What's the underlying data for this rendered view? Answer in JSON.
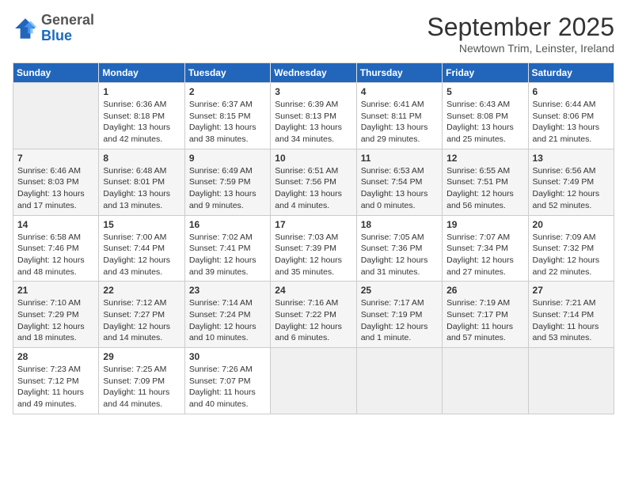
{
  "logo": {
    "general": "General",
    "blue": "Blue"
  },
  "header": {
    "month": "September 2025",
    "location": "Newtown Trim, Leinster, Ireland"
  },
  "weekdays": [
    "Sunday",
    "Monday",
    "Tuesday",
    "Wednesday",
    "Thursday",
    "Friday",
    "Saturday"
  ],
  "weeks": [
    [
      {
        "day": "",
        "info": ""
      },
      {
        "day": "1",
        "info": "Sunrise: 6:36 AM\nSunset: 8:18 PM\nDaylight: 13 hours\nand 42 minutes."
      },
      {
        "day": "2",
        "info": "Sunrise: 6:37 AM\nSunset: 8:15 PM\nDaylight: 13 hours\nand 38 minutes."
      },
      {
        "day": "3",
        "info": "Sunrise: 6:39 AM\nSunset: 8:13 PM\nDaylight: 13 hours\nand 34 minutes."
      },
      {
        "day": "4",
        "info": "Sunrise: 6:41 AM\nSunset: 8:11 PM\nDaylight: 13 hours\nand 29 minutes."
      },
      {
        "day": "5",
        "info": "Sunrise: 6:43 AM\nSunset: 8:08 PM\nDaylight: 13 hours\nand 25 minutes."
      },
      {
        "day": "6",
        "info": "Sunrise: 6:44 AM\nSunset: 8:06 PM\nDaylight: 13 hours\nand 21 minutes."
      }
    ],
    [
      {
        "day": "7",
        "info": "Sunrise: 6:46 AM\nSunset: 8:03 PM\nDaylight: 13 hours\nand 17 minutes."
      },
      {
        "day": "8",
        "info": "Sunrise: 6:48 AM\nSunset: 8:01 PM\nDaylight: 13 hours\nand 13 minutes."
      },
      {
        "day": "9",
        "info": "Sunrise: 6:49 AM\nSunset: 7:59 PM\nDaylight: 13 hours\nand 9 minutes."
      },
      {
        "day": "10",
        "info": "Sunrise: 6:51 AM\nSunset: 7:56 PM\nDaylight: 13 hours\nand 4 minutes."
      },
      {
        "day": "11",
        "info": "Sunrise: 6:53 AM\nSunset: 7:54 PM\nDaylight: 13 hours\nand 0 minutes."
      },
      {
        "day": "12",
        "info": "Sunrise: 6:55 AM\nSunset: 7:51 PM\nDaylight: 12 hours\nand 56 minutes."
      },
      {
        "day": "13",
        "info": "Sunrise: 6:56 AM\nSunset: 7:49 PM\nDaylight: 12 hours\nand 52 minutes."
      }
    ],
    [
      {
        "day": "14",
        "info": "Sunrise: 6:58 AM\nSunset: 7:46 PM\nDaylight: 12 hours\nand 48 minutes."
      },
      {
        "day": "15",
        "info": "Sunrise: 7:00 AM\nSunset: 7:44 PM\nDaylight: 12 hours\nand 43 minutes."
      },
      {
        "day": "16",
        "info": "Sunrise: 7:02 AM\nSunset: 7:41 PM\nDaylight: 12 hours\nand 39 minutes."
      },
      {
        "day": "17",
        "info": "Sunrise: 7:03 AM\nSunset: 7:39 PM\nDaylight: 12 hours\nand 35 minutes."
      },
      {
        "day": "18",
        "info": "Sunrise: 7:05 AM\nSunset: 7:36 PM\nDaylight: 12 hours\nand 31 minutes."
      },
      {
        "day": "19",
        "info": "Sunrise: 7:07 AM\nSunset: 7:34 PM\nDaylight: 12 hours\nand 27 minutes."
      },
      {
        "day": "20",
        "info": "Sunrise: 7:09 AM\nSunset: 7:32 PM\nDaylight: 12 hours\nand 22 minutes."
      }
    ],
    [
      {
        "day": "21",
        "info": "Sunrise: 7:10 AM\nSunset: 7:29 PM\nDaylight: 12 hours\nand 18 minutes."
      },
      {
        "day": "22",
        "info": "Sunrise: 7:12 AM\nSunset: 7:27 PM\nDaylight: 12 hours\nand 14 minutes."
      },
      {
        "day": "23",
        "info": "Sunrise: 7:14 AM\nSunset: 7:24 PM\nDaylight: 12 hours\nand 10 minutes."
      },
      {
        "day": "24",
        "info": "Sunrise: 7:16 AM\nSunset: 7:22 PM\nDaylight: 12 hours\nand 6 minutes."
      },
      {
        "day": "25",
        "info": "Sunrise: 7:17 AM\nSunset: 7:19 PM\nDaylight: 12 hours\nand 1 minute."
      },
      {
        "day": "26",
        "info": "Sunrise: 7:19 AM\nSunset: 7:17 PM\nDaylight: 11 hours\nand 57 minutes."
      },
      {
        "day": "27",
        "info": "Sunrise: 7:21 AM\nSunset: 7:14 PM\nDaylight: 11 hours\nand 53 minutes."
      }
    ],
    [
      {
        "day": "28",
        "info": "Sunrise: 7:23 AM\nSunset: 7:12 PM\nDaylight: 11 hours\nand 49 minutes."
      },
      {
        "day": "29",
        "info": "Sunrise: 7:25 AM\nSunset: 7:09 PM\nDaylight: 11 hours\nand 44 minutes."
      },
      {
        "day": "30",
        "info": "Sunrise: 7:26 AM\nSunset: 7:07 PM\nDaylight: 11 hours\nand 40 minutes."
      },
      {
        "day": "",
        "info": ""
      },
      {
        "day": "",
        "info": ""
      },
      {
        "day": "",
        "info": ""
      },
      {
        "day": "",
        "info": ""
      }
    ]
  ]
}
